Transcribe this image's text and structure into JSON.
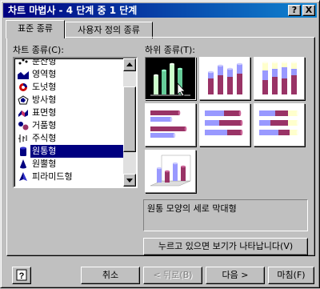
{
  "window": {
    "title": "차트 마법사 - 4 단계 중 1 단계"
  },
  "titlebar_buttons": {
    "help": "?",
    "close": "X"
  },
  "tabs": [
    {
      "label": "표준 종류"
    },
    {
      "label": "사용자 정의 종류"
    }
  ],
  "chart_type": {
    "label": "차트 종류(C):",
    "items": [
      {
        "label": "분산형",
        "icon": "scatter-icon"
      },
      {
        "label": "영역형",
        "icon": "area-icon"
      },
      {
        "label": "도넛형",
        "icon": "doughnut-icon"
      },
      {
        "label": "방사형",
        "icon": "radar-icon"
      },
      {
        "label": "표면형",
        "icon": "surface-icon"
      },
      {
        "label": "거품형",
        "icon": "bubble-icon"
      },
      {
        "label": "주식형",
        "icon": "stock-icon"
      },
      {
        "label": "원통형",
        "icon": "cylinder-icon"
      },
      {
        "label": "원뿔형",
        "icon": "cone-icon"
      },
      {
        "label": "피라미드형",
        "icon": "pyramid-icon"
      }
    ],
    "selected": "원통형"
  },
  "subtype": {
    "label": "하위 종류(T):",
    "description": "원통 모양의 세로 막대형"
  },
  "preview_button": "누르고 있으면 보기가 나타납니다(V)",
  "help_button": "?",
  "buttons": {
    "cancel": "취소",
    "back": "< 뒤로(B)",
    "next": "다음 >",
    "finish": "마침(F)"
  },
  "colors": {
    "bar_a": "#9999ff",
    "bar_b": "#993366",
    "bar_c": "#ffffcc",
    "selected": "#000080"
  }
}
